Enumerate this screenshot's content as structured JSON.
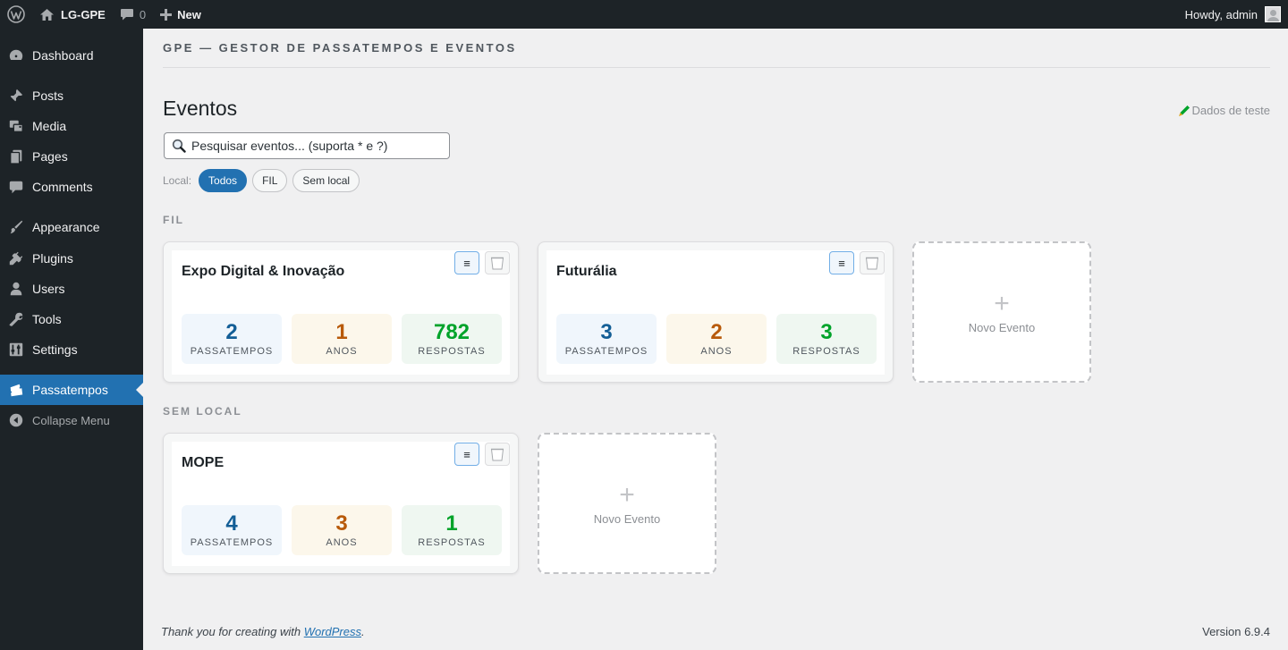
{
  "admin_bar": {
    "site_name": "LG-GPE",
    "comments_count": "0",
    "new_label": "New",
    "howdy": "Howdy, admin"
  },
  "sidebar": {
    "items": [
      {
        "label": "Dashboard",
        "icon": "dashboard-icon"
      },
      {
        "label": "Posts",
        "icon": "pushpin-icon"
      },
      {
        "label": "Media",
        "icon": "media-icon"
      },
      {
        "label": "Pages",
        "icon": "pages-icon"
      },
      {
        "label": "Comments",
        "icon": "comment-icon"
      },
      {
        "label": "Appearance",
        "icon": "brush-icon"
      },
      {
        "label": "Plugins",
        "icon": "plugin-icon"
      },
      {
        "label": "Users",
        "icon": "user-icon"
      },
      {
        "label": "Tools",
        "icon": "wrench-icon"
      },
      {
        "label": "Settings",
        "icon": "settings-icon"
      },
      {
        "label": "Passatempos",
        "icon": "tickets-icon"
      },
      {
        "label": "Collapse Menu",
        "icon": "collapse-icon"
      }
    ]
  },
  "main": {
    "plugin_header": "GPE — GESTOR DE PASSATEMPOS E EVENTOS",
    "page_title": "Eventos",
    "test_data_link": "Dados de teste",
    "search_placeholder": "Pesquisar eventos... (suporta * e ?)",
    "filter_label": "Local:",
    "filters": [
      "Todos",
      "FIL",
      "Sem local"
    ],
    "active_filter": "Todos",
    "new_event_label": "Novo Evento",
    "groups": [
      {
        "title": "FIL",
        "events": [
          {
            "name": "Expo Digital & Inovação",
            "passatempos": "2",
            "anos": "1",
            "respostas": "782"
          },
          {
            "name": "Futurália",
            "passatempos": "3",
            "anos": "2",
            "respostas": "3"
          }
        ]
      },
      {
        "title": "SEM LOCAL",
        "events": [
          {
            "name": "MOPE",
            "passatempos": "4",
            "anos": "3",
            "respostas": "1"
          }
        ]
      }
    ],
    "stat_labels": {
      "passatempos": "PASSATEMPOS",
      "anos": "ANOS",
      "respostas": "RESPOSTAS"
    }
  },
  "footer": {
    "thanks_prefix": "Thank you for creating with ",
    "thanks_link": "WordPress",
    "thanks_suffix": ".",
    "version": "Version 6.9.4"
  },
  "colors": {
    "admin_bar_bg": "#1d2327",
    "accent": "#2271b1",
    "passatempos": "#135e96",
    "anos": "#b85a0a",
    "respostas": "#00a32a"
  }
}
